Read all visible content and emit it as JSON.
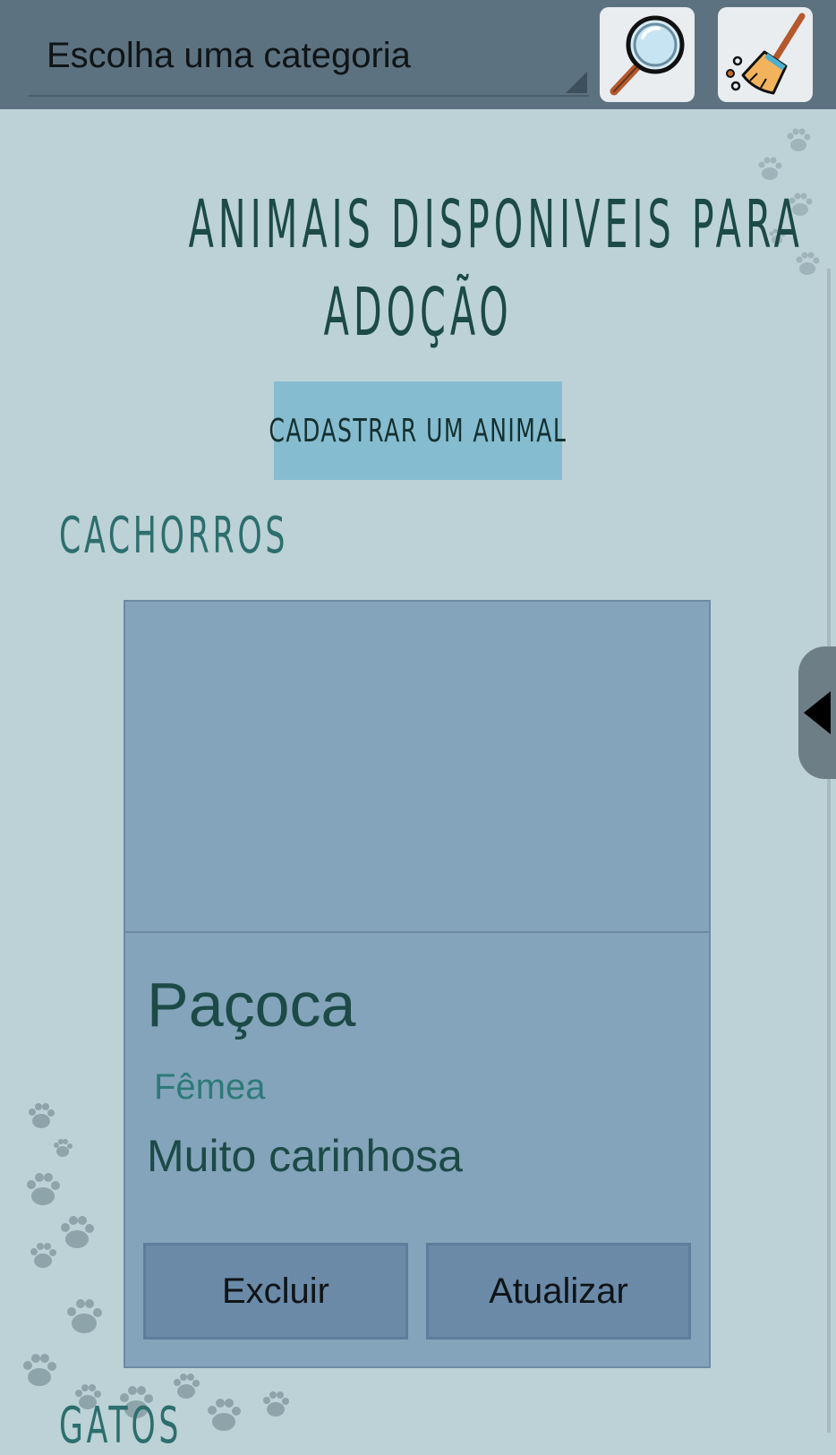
{
  "topbar": {
    "category_select": {
      "label": "Escolha uma categoria"
    },
    "search_icon": "magnifier-icon",
    "clear_icon": "broom-icon"
  },
  "page": {
    "title_line1": "ANIMAIS DISPONIVEIS PARA",
    "title_line2": "ADOÇÃO",
    "register_button": "CADASTRAR UM ANIMAL"
  },
  "sections": [
    {
      "title": "CACHORROS",
      "cards": [
        {
          "name": "Paçoca",
          "sex": "Fêmea",
          "description": "Muito carinhosa",
          "delete_label": "Excluir",
          "update_label": "Atualizar"
        }
      ]
    },
    {
      "title": "GATOS"
    }
  ],
  "colors": {
    "background": "#bcd2d7",
    "topbar": "#5c7280",
    "card": "#84a4bb",
    "accent": "#86bcd0",
    "title": "#1c4a47"
  }
}
